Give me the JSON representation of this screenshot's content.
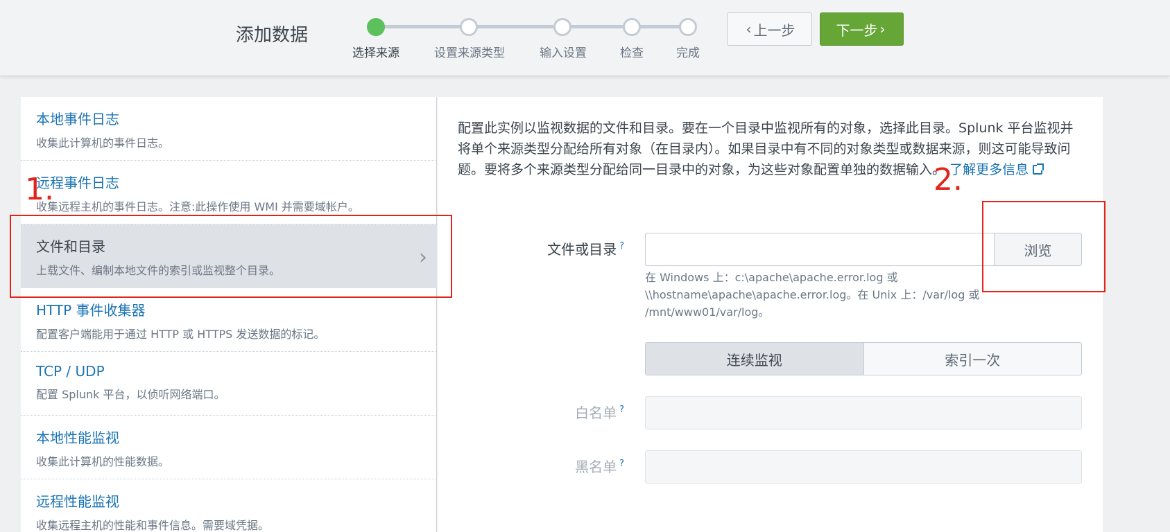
{
  "header": {
    "title": "添加数据",
    "steps": [
      {
        "label": "选择来源",
        "active": true
      },
      {
        "label": "设置来源类型",
        "active": false
      },
      {
        "label": "输入设置",
        "active": false
      },
      {
        "label": "检查",
        "active": false
      },
      {
        "label": "完成",
        "active": false
      }
    ],
    "prev_label": "上一步",
    "next_label": "下一步"
  },
  "sources": [
    {
      "title": "本地事件日志",
      "desc": "收集此计算机的事件日志。"
    },
    {
      "title": "远程事件日志",
      "desc": "收集远程主机的事件日志。注意:此操作使用 WMI 并需要域帐户。"
    },
    {
      "title": "文件和目录",
      "desc": "上载文件、编制本地文件的索引或监视整个目录。",
      "selected": true
    },
    {
      "title": "HTTP 事件收集器",
      "desc": "配置客户端能用于通过 HTTP 或 HTTPS 发送数据的标记。"
    },
    {
      "title": "TCP / UDP",
      "desc": "配置 Splunk 平台，以侦听网络端口。"
    },
    {
      "title": "本地性能监视",
      "desc": "收集此计算机的性能数据。"
    },
    {
      "title": "远程性能监视",
      "desc": "收集远程主机的性能和事件信息。需要域凭据。"
    }
  ],
  "main": {
    "description": "配置此实例以监视数据的文件和目录。要在一个目录中监视所有的对象，选择此目录。Splunk 平台监视并将单个来源类型分配给所有对象（在目录内）。如果目录中有不同的对象类型或数据来源，则这可能导致问题。要将多个来源类型分配给同一目录中的对象，为这些对象配置单独的数据输入。",
    "learn_more": "了解更多信息",
    "file_label": "文件或目录",
    "file_value": "",
    "browse_label": "浏览",
    "hint": "在 Windows 上：c:\\apache\\apache.error.log 或 \\\\hostname\\apache\\apache.error.log。在 Unix 上：/var/log 或 /mnt/www01/var/log。",
    "mode_continuous": "连续监视",
    "mode_once": "索引一次",
    "whitelist_label": "白名单",
    "whitelist_value": "",
    "blacklist_label": "黑名单",
    "blacklist_value": "",
    "help_mark": "?"
  },
  "annotations": {
    "one": "1.",
    "two": "2."
  },
  "colors": {
    "accent_green": "#65a637",
    "active_step": "#5cc05c",
    "link_blue": "#1a73b4",
    "annotation_red": "#e2231a"
  }
}
